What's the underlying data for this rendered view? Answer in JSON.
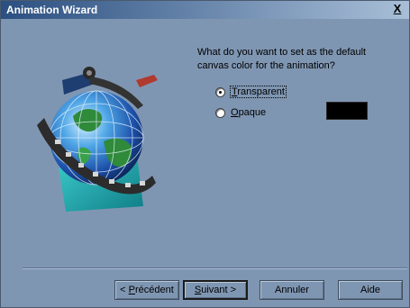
{
  "window": {
    "title": "Animation Wizard",
    "close_glyph": "X"
  },
  "illustration": {
    "icon": "globe-film-icon"
  },
  "question": {
    "line1": "What do you want to set as the default",
    "line2": "canvas color for the animation?"
  },
  "options": [
    {
      "mnemonic": "T",
      "rest": "ransparent",
      "selected": true
    },
    {
      "mnemonic": "O",
      "rest": "paque",
      "selected": false
    }
  ],
  "opaque_color": "#000000",
  "buttons": {
    "back_prefix": "< ",
    "back_mnemonic": "P",
    "back_rest": "récédent",
    "next_mnemonic": "S",
    "next_rest": "uivant >",
    "cancel": "Annuler",
    "help": "Aide"
  },
  "colors": {
    "dialog_bg": "#7f96b2",
    "title_start": "#2a4f80",
    "title_end": "#a9bfd8"
  }
}
